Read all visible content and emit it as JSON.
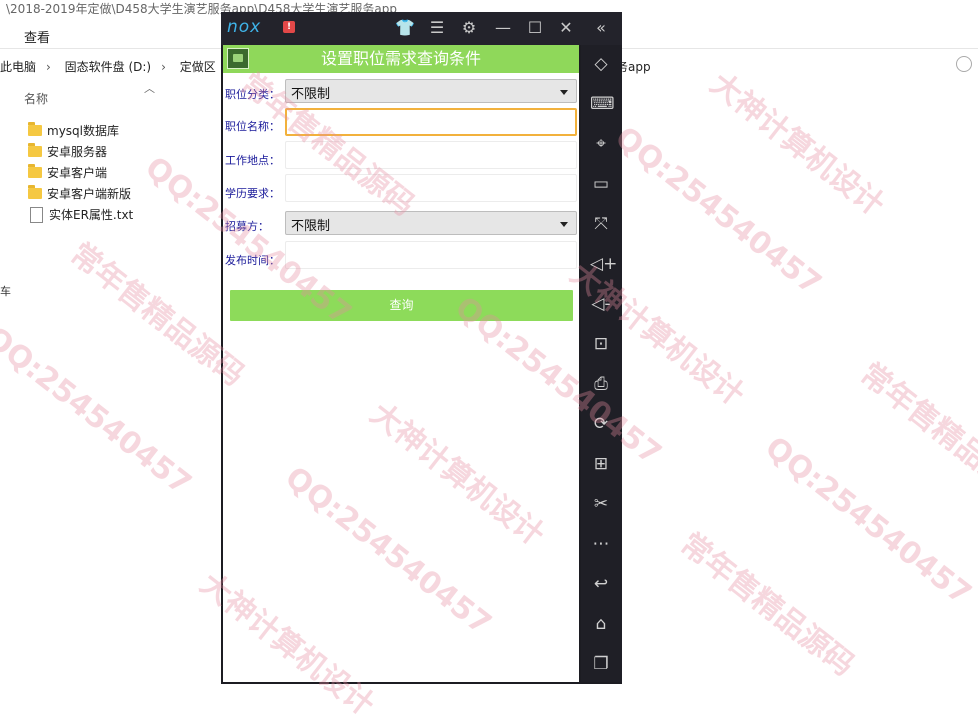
{
  "explorer": {
    "title_path": "\\2018-2019年定做\\D458大学生演艺服务app\\D458大学生演艺服务app",
    "ribbon_view": "查看",
    "address": [
      "此电脑",
      "固态软件盘 (D:)",
      "定做区"
    ],
    "address_right": "务app",
    "column_name": "名称",
    "files": [
      {
        "name": "mysql数据库",
        "type": "folder"
      },
      {
        "name": "安卓服务器",
        "type": "folder"
      },
      {
        "name": "安卓客户端",
        "type": "folder"
      },
      {
        "name": "安卓客户端新版",
        "type": "folder"
      },
      {
        "name": "实体ER属性.txt",
        "type": "file"
      }
    ],
    "left_edge_char": "车"
  },
  "emulator": {
    "logo": "nox",
    "alert": "!",
    "titlebar_icons": [
      "shirt-icon",
      "menu-icon",
      "gear-icon",
      "minimize-icon",
      "maximize-icon",
      "close-icon"
    ],
    "collapse_icon": "«",
    "sidebar_icons": [
      "eraser-icon",
      "keyboard-icon",
      "location-icon",
      "screen-icon",
      "fullscreen-icon",
      "volume-up-icon",
      "volume-down-icon",
      "screenshot-icon",
      "print-icon",
      "shake-icon",
      "apk-icon",
      "scissors-icon",
      "more-icon",
      "back-icon",
      "home-icon",
      "recent-apps-icon"
    ]
  },
  "app": {
    "title": "设置职位需求查询条件",
    "fields": {
      "category_label": "职位分类：",
      "category_value": "不限制",
      "position_label": "职位名称：",
      "position_value": "",
      "location_label": "工作地点：",
      "location_value": "",
      "education_label": "学历要求：",
      "education_value": "",
      "recruiter_label": "招募方：",
      "recruiter_value": "不限制",
      "publish_time_label": "发布时间：",
      "publish_time_value": ""
    },
    "query_button": "查询"
  },
  "watermarks": [
    "常年售精品源码",
    "QQ:254540457",
    "大神计算机设计"
  ]
}
